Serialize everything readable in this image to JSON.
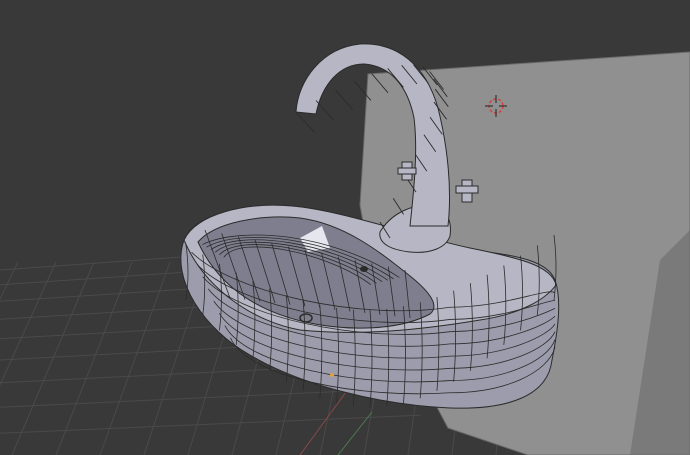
{
  "viewport": {
    "view_mode": "3d-viewport",
    "shading": "solid",
    "overlay": "wireframe",
    "floor_grid": true,
    "object": "sink-with-faucet"
  },
  "colors": {
    "background": "#393939",
    "grid_line": "#4a4a4a",
    "axis_x": "#8a4848",
    "axis_y": "#4e7a4e",
    "wall": "#909090",
    "wall_shadow": "#6c6c6c",
    "mesh_light": "#b6b6c4",
    "mesh_mid": "#9c9cac",
    "mesh_dark": "#7e7e8e",
    "mesh_highlight": "#e6e6ee",
    "wire": "#2b2b2b",
    "cursor_ring": "#d24040",
    "cursor_cross": "#222222"
  },
  "icons": {
    "cursor": "3d-cursor-icon",
    "object_origin": "object-origin-icon"
  }
}
